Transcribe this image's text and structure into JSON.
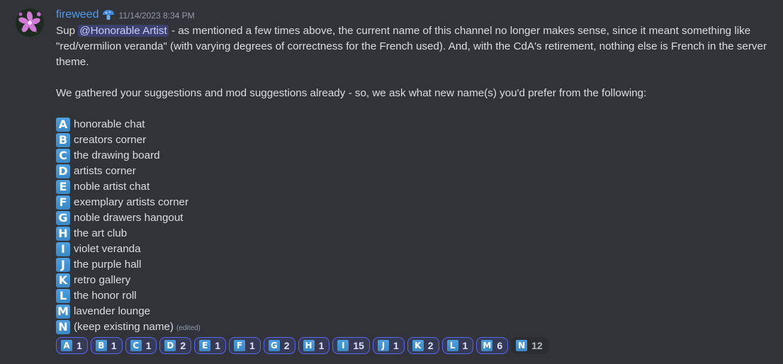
{
  "message": {
    "author": "fireweed",
    "timestamp": "11/14/2023 8:34 PM",
    "role_icon": "blue-mushroom-icon",
    "intro": {
      "prefix": "Sup ",
      "mention": "@Honorable Artist",
      "suffix": " - as mentioned a few times above, the current name of this channel no longer makes sense, since it meant something like \"red/vermilion veranda\" (with varying degrees of correctness for the French used). And, with the CdA's retirement, nothing else is French in the server theme."
    },
    "request": "We gathered your suggestions and mod suggestions already - so, we ask what new name(s) you'd prefer from the following:",
    "options": [
      {
        "letter": "A",
        "text": "honorable chat"
      },
      {
        "letter": "B",
        "text": "creators corner"
      },
      {
        "letter": "C",
        "text": "the drawing board"
      },
      {
        "letter": "D",
        "text": "artists corner"
      },
      {
        "letter": "E",
        "text": "noble artist chat"
      },
      {
        "letter": "F",
        "text": "exemplary artists corner"
      },
      {
        "letter": "G",
        "text": "noble drawers hangout"
      },
      {
        "letter": "H",
        "text": "the art club"
      },
      {
        "letter": "I",
        "text": "violet veranda"
      },
      {
        "letter": "J",
        "text": "the purple hall"
      },
      {
        "letter": "K",
        "text": "retro gallery"
      },
      {
        "letter": "L",
        "text": "the honor roll"
      },
      {
        "letter": "M",
        "text": "lavender lounge"
      },
      {
        "letter": "N",
        "text": "(keep existing name)"
      }
    ],
    "edited_label": "(edited)"
  },
  "reactions": [
    {
      "letter": "A",
      "count": "1",
      "selected": true
    },
    {
      "letter": "B",
      "count": "1",
      "selected": true
    },
    {
      "letter": "C",
      "count": "1",
      "selected": true
    },
    {
      "letter": "D",
      "count": "2",
      "selected": true
    },
    {
      "letter": "E",
      "count": "1",
      "selected": true
    },
    {
      "letter": "F",
      "count": "1",
      "selected": true
    },
    {
      "letter": "G",
      "count": "2",
      "selected": true
    },
    {
      "letter": "H",
      "count": "1",
      "selected": true
    },
    {
      "letter": "I",
      "count": "15",
      "selected": true
    },
    {
      "letter": "J",
      "count": "1",
      "selected": true
    },
    {
      "letter": "K",
      "count": "2",
      "selected": true
    },
    {
      "letter": "L",
      "count": "1",
      "selected": true
    },
    {
      "letter": "M",
      "count": "6",
      "selected": true
    },
    {
      "letter": "N",
      "count": "12",
      "selected": false
    }
  ],
  "colors": {
    "background": "#313338",
    "username": "#4e9cf0",
    "badge": "#3b88c3",
    "reaction_selected_border": "#5865f2"
  }
}
